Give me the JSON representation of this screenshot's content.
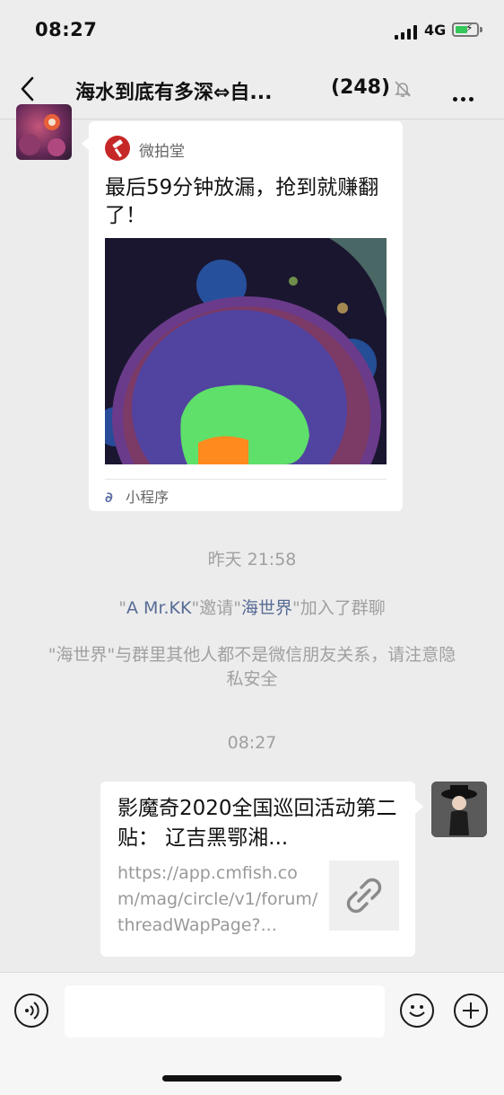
{
  "status_bar": {
    "time": "08:27",
    "network": "4G"
  },
  "nav": {
    "title": "海水到底有多深⇔自...",
    "member_count": "(248)"
  },
  "mini_program": {
    "app_name": "微拍堂",
    "title": "最后59分钟放漏，抢到就赚翻了！",
    "tag": "小程序"
  },
  "timestamps": {
    "yesterday": "昨天 21:58",
    "now": "08:27"
  },
  "invite": {
    "q1": "\"",
    "inviter": "A  Mr.KK",
    "q2": "\"邀请\"",
    "invitee": "海世界",
    "q3": "\"加入了群聊"
  },
  "privacy_notice": "\"海世界\"与群里其他人都不是微信朋友关系，请注意隐私安全",
  "link_message": {
    "title": "影魔奇2020全国巡回活动第二贴： 辽吉黑鄂湘...",
    "url": "https://app.cmfish.com/mag/circle/v1/forum/threadWapPage?..."
  },
  "input_bar": {
    "placeholder": ""
  }
}
